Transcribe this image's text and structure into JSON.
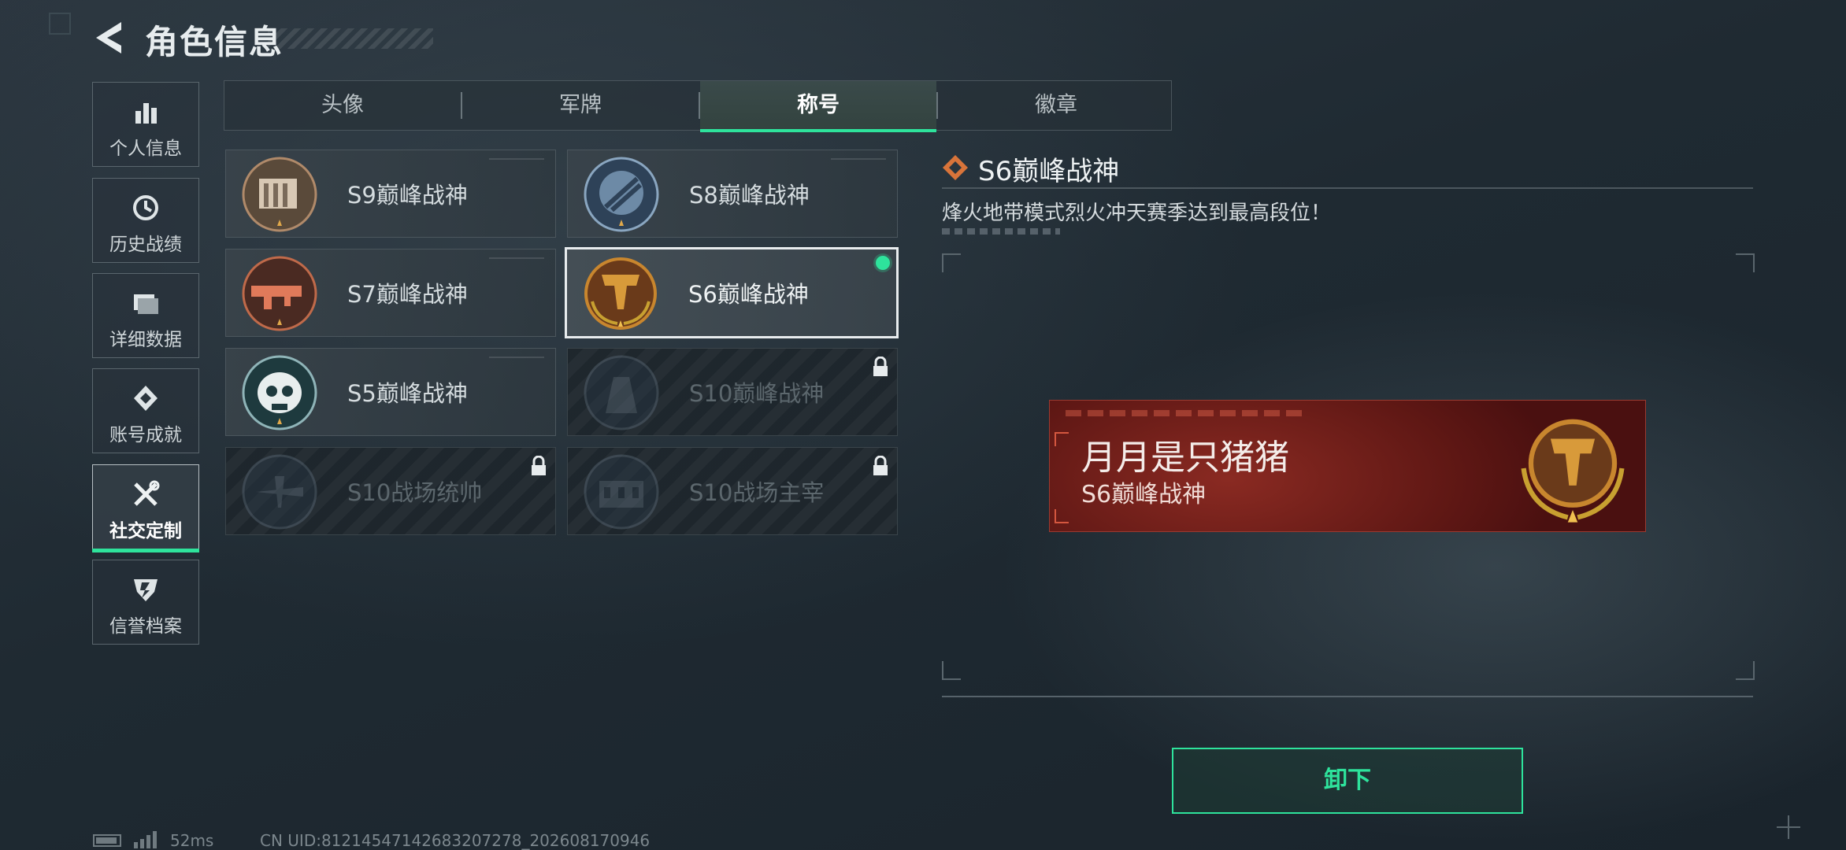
{
  "header": {
    "title": "角色信息",
    "back_icon": "back-arrow-icon"
  },
  "sidebar": {
    "items": [
      {
        "label": "个人信息",
        "icon": "bar-chart-icon"
      },
      {
        "label": "历史战绩",
        "icon": "history-clock-icon"
      },
      {
        "label": "详细数据",
        "icon": "folder-icon"
      },
      {
        "label": "账号成就",
        "icon": "medal-icon"
      },
      {
        "label": "社交定制",
        "icon": "tools-icon",
        "active": true
      },
      {
        "label": "信誉档案",
        "icon": "shield-icon"
      }
    ]
  },
  "tabs": [
    {
      "label": "头像"
    },
    {
      "label": "军牌"
    },
    {
      "label": "称号",
      "active": true
    },
    {
      "label": "徽章"
    }
  ],
  "titles": [
    {
      "name": "S9巅峰战神",
      "locked": false
    },
    {
      "name": "S8巅峰战神",
      "locked": false
    },
    {
      "name": "S7巅峰战神",
      "locked": false
    },
    {
      "name": "S6巅峰战神",
      "locked": false,
      "selected": true,
      "equipped": true
    },
    {
      "name": "S5巅峰战神",
      "locked": false
    },
    {
      "name": "S10巅峰战神",
      "locked": true
    },
    {
      "name": "S10战场统帅",
      "locked": true
    },
    {
      "name": "S10战场主宰",
      "locked": true
    }
  ],
  "detail": {
    "title": "S6巅峰战神",
    "description": "烽火地带模式烈火冲天赛季达到最高段位！",
    "preview": {
      "player_name": "月月是只猪猪",
      "title": "S6巅峰战神"
    },
    "action_label": "卸下"
  },
  "status": {
    "ping": "52ms",
    "uid": "CN UID:81214547142683207278_202608170946"
  },
  "colors": {
    "accent": "#2ee39c",
    "banner": "#7a221c",
    "title_gold": "#c8862e"
  }
}
